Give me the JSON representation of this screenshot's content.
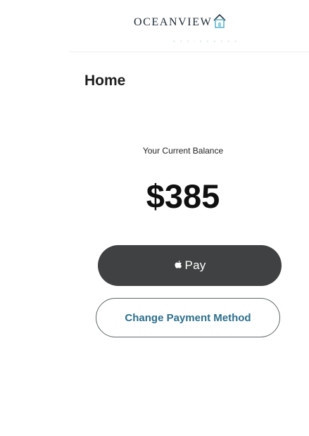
{
  "header": {
    "logo_text": "OCEANVIEW",
    "logo_subtext": "R E S I D E N C E S"
  },
  "page": {
    "title": "Home"
  },
  "balance": {
    "label": "Your Current Balance",
    "amount": "$385"
  },
  "actions": {
    "pay_label": "Pay",
    "change_payment_label": "Change Payment Method"
  },
  "colors": {
    "pay_button_bg": "#404142",
    "change_button_text": "#2d6f8b",
    "logo_accent": "#5fb3c9"
  },
  "icons": {
    "logo": "house-icon",
    "pay": "apple-icon"
  }
}
